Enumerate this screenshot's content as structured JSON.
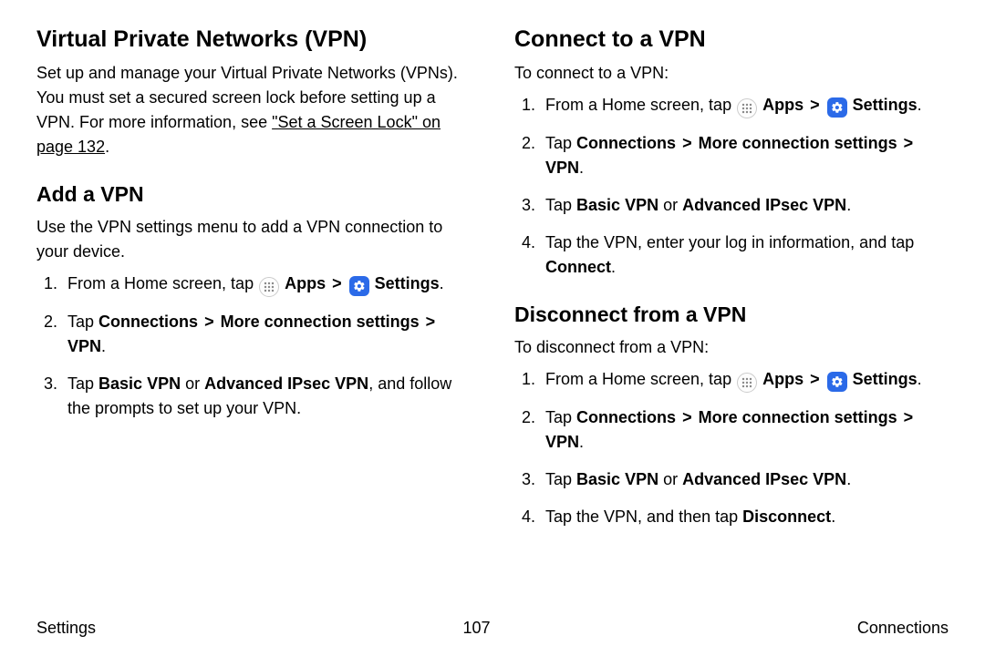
{
  "left": {
    "h2": "Virtual Private Networks (VPN)",
    "intro_pre": "Set up and manage your Virtual Private Networks (VPNs). You must set a secured screen lock before setting up a VPN. For more information, see ",
    "intro_link": "\"Set a Screen Lock\" on page 132",
    "intro_post": ".",
    "add_h3": "Add a VPN",
    "add_intro": "Use the VPN settings menu to add a VPN connection to your device.",
    "steps": {
      "s1_pre": "From a Home screen, tap ",
      "apps_label": "Apps",
      "settings_label": "Settings",
      "s2_tap": "Tap ",
      "s2_connections": "Connections",
      "s2_more": "More connection settings",
      "s2_vpn": "VPN",
      "s3_pre": "Tap ",
      "s3_basic": "Basic VPN",
      "s3_or": " or ",
      "s3_adv": "Advanced IPsec VPN",
      "s3_post": ", and follow the prompts to set up your VPN."
    }
  },
  "right": {
    "connect_h2": "Connect to a VPN",
    "connect_intro": "To connect to a VPN:",
    "c4_pre": "Tap the VPN, enter your log in information, and tap ",
    "c4_bold": "Connect",
    "disc_h3": "Disconnect from a VPN",
    "disc_intro": "To disconnect from a VPN:",
    "d4_pre": "Tap the VPN, and then tap ",
    "d4_bold": "Disconnect"
  },
  "shared": {
    "chevron": ">",
    "period": "."
  },
  "footer": {
    "left": "Settings",
    "center": "107",
    "right": "Connections"
  }
}
